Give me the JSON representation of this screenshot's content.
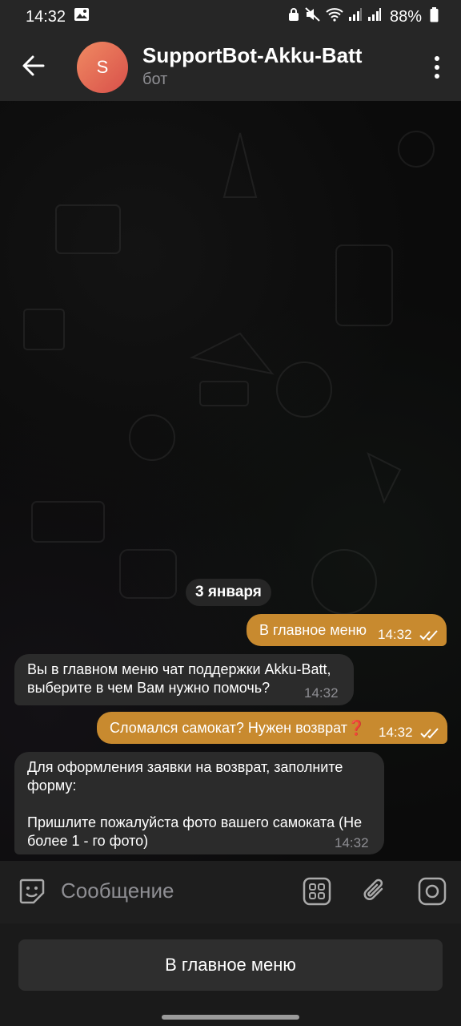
{
  "status_bar": {
    "time": "14:32",
    "battery": "88%"
  },
  "header": {
    "title": "SupportBot-Akku-Batt",
    "subtitle": "бот",
    "avatar_letter": "S"
  },
  "chat": {
    "date_chip": "3 января",
    "messages": [
      {
        "direction": "out",
        "text": "В главное меню",
        "time": "14:32",
        "status": "read"
      },
      {
        "direction": "in",
        "lines": [
          "Вы в главном меню чат поддержки Akku-Batt,",
          "выберите в чем Вам нужно помочь?"
        ],
        "time": "14:32"
      },
      {
        "direction": "out",
        "text": "Сломался самокат? Нужен возврат❓",
        "time": "14:32",
        "status": "read"
      },
      {
        "direction": "in",
        "lines": [
          "Для оформления заявки на возврат, заполните",
          "форму:",
          "",
          "Пришлите пожалуйста фото вашего самоката (Не",
          "более 1 - го фото)"
        ],
        "time": "14:32"
      }
    ]
  },
  "input": {
    "placeholder": "Сообщение"
  },
  "keyboard": {
    "button_label": "В главное меню"
  },
  "colors": {
    "outgoing_bubble": "#c88a2f",
    "incoming_bubble": "#2b2b2b",
    "header_bg": "#262626"
  }
}
